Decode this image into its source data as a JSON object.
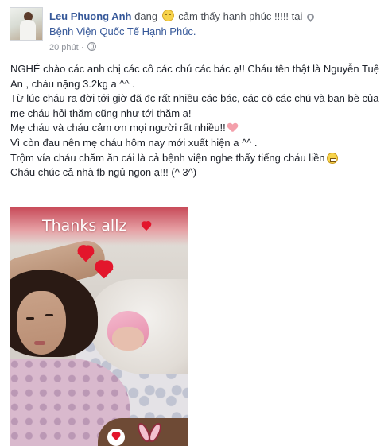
{
  "post": {
    "author": "Leu Phuong Anh",
    "feeling_prefix": "đang",
    "feeling_text": "cảm thấy hạnh phúc !!!!! tại",
    "place": "Bệnh Viện Quốc Tế Hạnh Phúc.",
    "timestamp": "20 phút ·",
    "icons": {
      "feeling": "smile-emoji-icon",
      "location": "map-pin-icon",
      "privacy": "globe-icon"
    },
    "message": {
      "line1": "NGHÉ chào các anh chị các cô các chú các bác ạ!! Cháu tên thật là Nguyễn Tuệ An , cháu nặng 3.2kg a ^^ .",
      "line2": "Từ lúc cháu ra đời tới giờ đã đc rất nhiều các bác, các cô các chú và bạn bè của mẹ cháu hỏi thăm cũng như tới thăm ạ!",
      "line3": "Mẹ cháu và cháu cảm ơn mọi người rất nhiều!!",
      "line4": "Vì còn đau nên mẹ cháu hôm nay mới xuất hiện a ^^ .",
      "line5": "Trộm vía cháu chăm ăn cái là cả bệnh viện nghe thấy tiếng cháu liền",
      "line6": "Cháu chúc cả nhà fb ngủ ngon ạ!!! (^ 3^)",
      "emoji_line3": "heart-emoji-icon",
      "emoji_line5": "grin-emoji-icon"
    },
    "photo": {
      "caption": "Thanks allz",
      "colors": {
        "banner": "#c84c5a",
        "heart": "#e3162c"
      }
    },
    "colors": {
      "link": "#365899",
      "text": "#1d2129",
      "meta": "#90949c"
    }
  }
}
